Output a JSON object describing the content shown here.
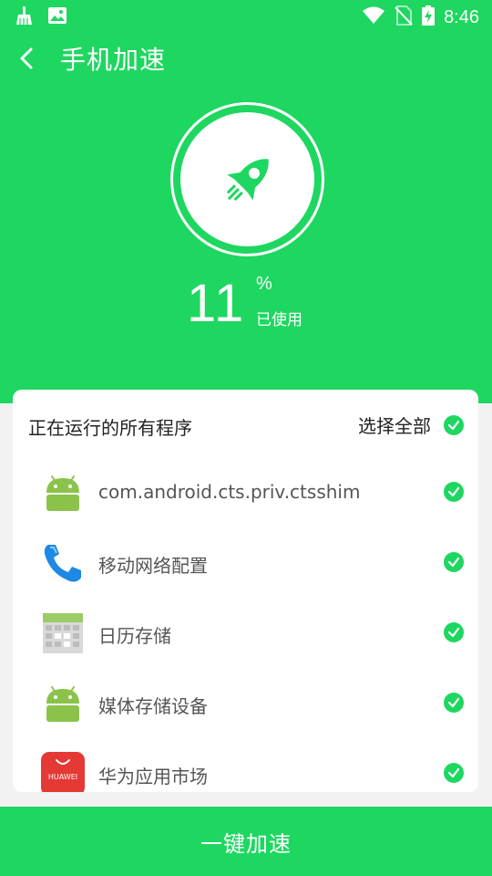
{
  "status_bar": {
    "time": "8:46",
    "left_icons": [
      "broom-icon",
      "image-icon"
    ],
    "right_icons": [
      "wifi-icon",
      "no-sim-icon",
      "battery-charging-icon"
    ]
  },
  "header": {
    "title": "手机加速",
    "back_icon": "chevron-left-icon",
    "usage_value": "11",
    "usage_unit": "%",
    "usage_label": "已使用",
    "badge_icon": "rocket-icon"
  },
  "card": {
    "title": "正在运行的所有程序",
    "select_all_label": "选择全部",
    "apps": [
      {
        "name": "com.android.cts.priv.ctsshim",
        "icon": "android-icon",
        "checked": true
      },
      {
        "name": "移动网络配置",
        "icon": "phone-icon",
        "checked": true
      },
      {
        "name": "日历存储",
        "icon": "calendar-icon",
        "checked": true
      },
      {
        "name": "媒体存储设备",
        "icon": "android-icon",
        "checked": true
      },
      {
        "name": "华为应用市场",
        "icon": "huawei-appgallery-icon",
        "icon_text": "HUAWEI",
        "checked": true
      }
    ]
  },
  "bottom": {
    "action_label": "一键加速"
  },
  "colors": {
    "primary_green": "#1ed760",
    "background": "#f2f2f2"
  }
}
